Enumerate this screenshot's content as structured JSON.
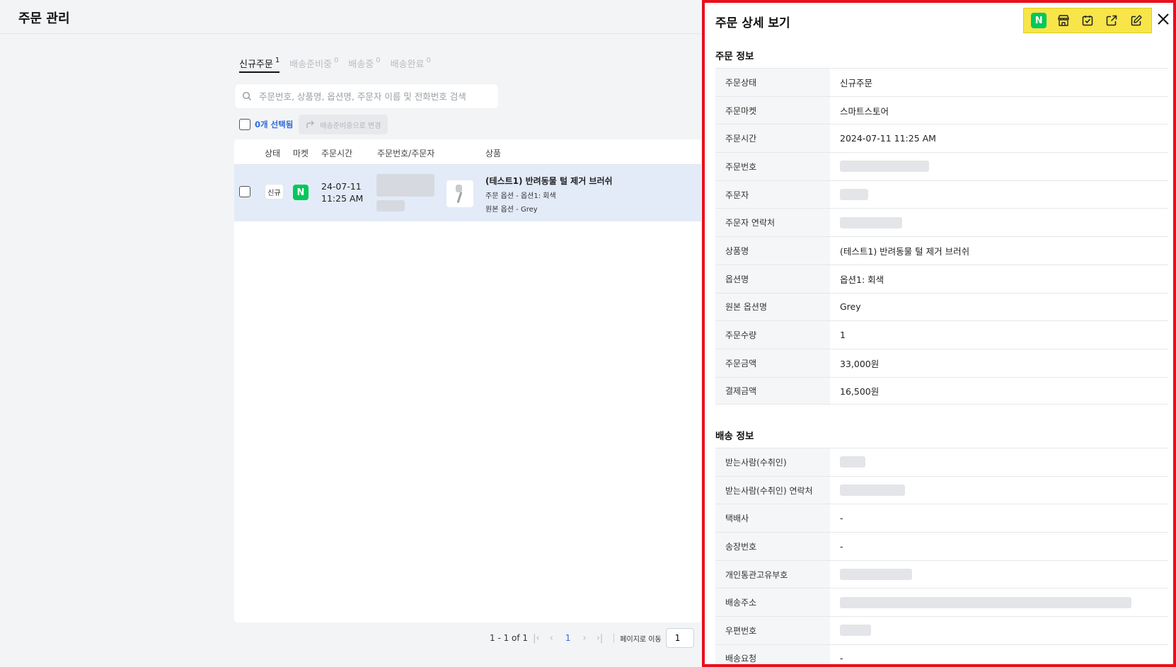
{
  "header": {
    "title": "주문 관리"
  },
  "tabs": [
    {
      "label": "신규주문",
      "count": "1",
      "active": true
    },
    {
      "label": "배송준비중",
      "count": "0",
      "active": false
    },
    {
      "label": "배송중",
      "count": "0",
      "active": false
    },
    {
      "label": "배송완료",
      "count": "0",
      "active": false
    }
  ],
  "search": {
    "placeholder": "주문번호, 상품명, 옵션명, 주문자 이름 및 전화번호 검색"
  },
  "selection": {
    "label": "0개 선택됨",
    "move_button": "배송준비중으로 변경"
  },
  "table": {
    "headers": {
      "status": "상태",
      "market": "마켓",
      "time": "주문시간",
      "order": "주문번호/주문자",
      "product": "상품"
    },
    "rows": [
      {
        "status": "신규",
        "market_icon": "N",
        "date": "24-07-11",
        "time": "11:25 AM",
        "product_name": "(테스트1) 반려동물 털 제거 브러쉬",
        "option": "주문 옵션 - 옵션1: 회색",
        "original_option": "원본 옵션 - Grey"
      }
    ]
  },
  "pagination": {
    "range": "1 - 1 of 1",
    "current": "1",
    "goto_label": "페이지로 이동",
    "goto_value": "1"
  },
  "drawer": {
    "title": "주문 상세 보기",
    "toolbar_icons": [
      "naver-store-icon",
      "store-icon",
      "checkbox-icon",
      "external-link-icon",
      "edit-icon"
    ],
    "order_section": {
      "title": "주문 정보",
      "rows": [
        {
          "key": "주문상태",
          "value": "신규주문"
        },
        {
          "key": "주문마켓",
          "value": "스마트스토어"
        },
        {
          "key": "주문시간",
          "value": "2024-07-11 11:25 AM"
        },
        {
          "key": "주문번호",
          "value": ""
        },
        {
          "key": "주문자",
          "value": ""
        },
        {
          "key": "주문자 연락처",
          "value": ""
        },
        {
          "key": "상품명",
          "value": "(테스트1) 반려동물 털 제거 브러쉬"
        },
        {
          "key": "옵션명",
          "value": "옵션1: 회색"
        },
        {
          "key": "원본 옵션명",
          "value": "Grey"
        },
        {
          "key": "주문수량",
          "value": "1"
        },
        {
          "key": "주문금액",
          "value": "33,000원"
        },
        {
          "key": "결제금액",
          "value": "16,500원"
        }
      ]
    },
    "shipping_section": {
      "title": "배송 정보",
      "rows": [
        {
          "key": "받는사람(수취인)",
          "value": ""
        },
        {
          "key": "받는사람(수취인) 연락처",
          "value": ""
        },
        {
          "key": "택배사",
          "value": "-"
        },
        {
          "key": "송장번호",
          "value": "-"
        },
        {
          "key": "개인통관고유부호",
          "value": ""
        },
        {
          "key": "배송주소",
          "value": ""
        },
        {
          "key": "우편번호",
          "value": ""
        },
        {
          "key": "배송요청",
          "value": "-"
        }
      ]
    }
  },
  "colors": {
    "highlight_border": "#e8101a",
    "toolbar_highlight": "#f7e54a",
    "naver_green": "#03c75a",
    "accent_blue": "#2f6bd6",
    "selected_row": "#e3ebf8"
  }
}
